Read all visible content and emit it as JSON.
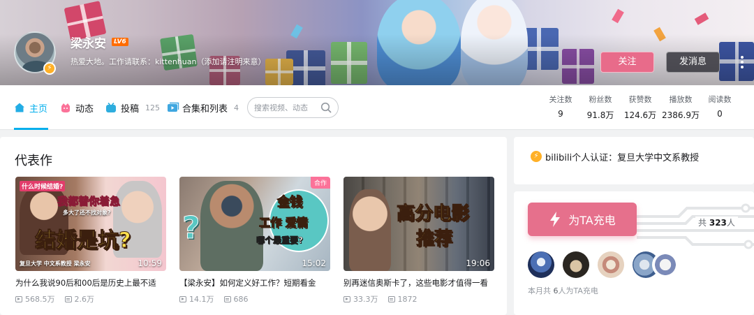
{
  "profile": {
    "name": "梁永安",
    "level": "LV6",
    "signature": "热爱大地。工作请联系：kittenhuan（添加请注明来意）",
    "follow_label": "关注",
    "message_label": "发消息"
  },
  "nav": {
    "tabs": [
      {
        "label": "主页",
        "count": ""
      },
      {
        "label": "动态",
        "count": ""
      },
      {
        "label": "投稿",
        "count": "125"
      },
      {
        "label": "合集和列表",
        "count": "4"
      }
    ],
    "search_placeholder": "搜索视频、动态"
  },
  "stats": [
    {
      "label": "关注数",
      "value": "9"
    },
    {
      "label": "粉丝数",
      "value": "91.8万"
    },
    {
      "label": "获赞数",
      "value": "124.6万"
    },
    {
      "label": "播放数",
      "value": "2386.9万"
    },
    {
      "label": "阅读数",
      "value": "0"
    }
  ],
  "works": {
    "title": "代表作",
    "videos": [
      {
        "title": "为什么我说90后和00后是历史上最不适",
        "duration": "10:59",
        "views": "568.5万",
        "danmaku": "2.6万",
        "thumb_text": {
          "headline": "结婚是坑?",
          "top1": "什么时候结婚?",
          "top2": "我都替你着急",
          "top3": "多大了还不找对象?",
          "caption": "复旦大学 中文系教授 梁永安"
        }
      },
      {
        "title": "【梁永安】如何定义好工作？短期看金",
        "duration": "15:02",
        "views": "14.1万",
        "danmaku": "686",
        "coop": "合作",
        "thumb_text": {
          "line1": "金钱",
          "line2": "工作 爱情",
          "line3": "哪个最重要?",
          "mark": "?"
        }
      },
      {
        "title": "别再迷信奥斯卡了，这些电影才值得一看",
        "duration": "19:06",
        "views": "33.3万",
        "danmaku": "1872",
        "thumb_text": {
          "line1": "高分电影",
          "line2": "推荐"
        }
      }
    ]
  },
  "certification": {
    "text": "bilibili个人认证：复旦大学中文系教授"
  },
  "charge": {
    "button_label": "为TA充电",
    "total_prefix": "共",
    "total": "323",
    "total_suffix": "人",
    "month_prefix": "本月共",
    "month_count": "6",
    "month_suffix": "人为TA充电"
  }
}
